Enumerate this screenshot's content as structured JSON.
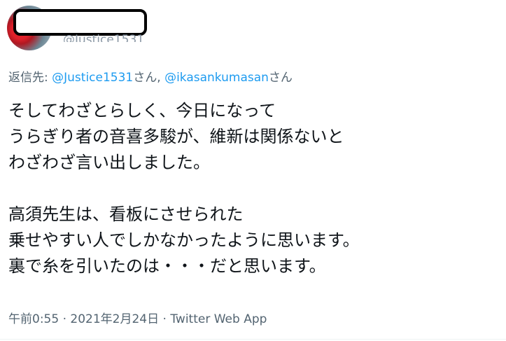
{
  "author": {
    "handle": "@Justice1531"
  },
  "reply": {
    "prefix": "返信先: ",
    "mention1": "@Justice1531",
    "suffix1": "さん, ",
    "mention2": "@ikasankumasan",
    "suffix2": "さん"
  },
  "tweet": {
    "paragraph1": [
      "そしてわざとらしく、今日になって",
      "うらぎり者の音喜多駿が、維新は関係ないと",
      "わざわざ言い出しました。"
    ],
    "paragraph2": [
      "高須先生は、看板にさせられた",
      "乗せやすい人でしかなかったように思います。",
      "裏で糸を引いたのは・・・だと思います。"
    ]
  },
  "meta": {
    "time": "午前0:55",
    "separator": " · ",
    "date": "2021年2月24日",
    "separator2": " · ",
    "source": "Twitter Web App"
  }
}
